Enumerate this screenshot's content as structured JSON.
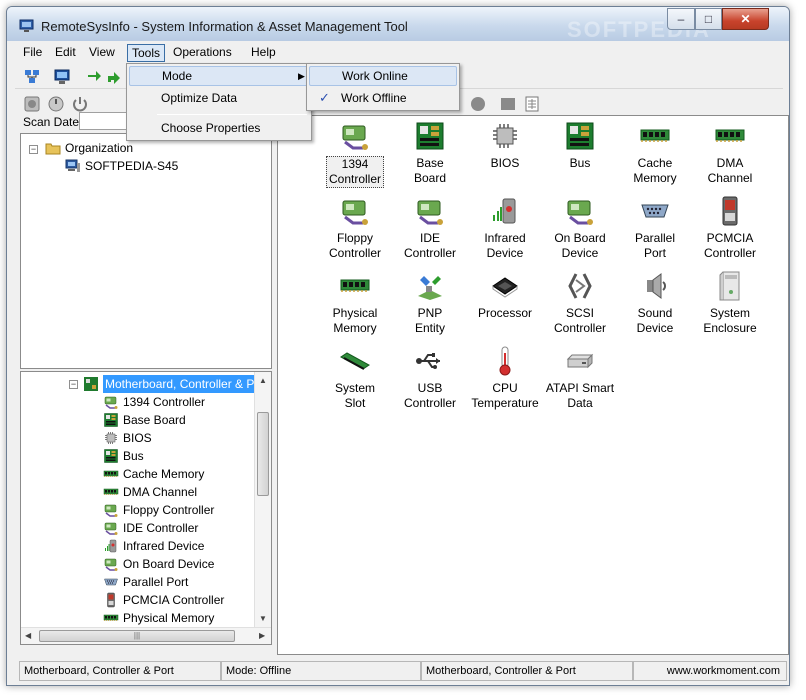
{
  "window": {
    "title": "RemoteSysInfo - System Information & Asset Management Tool",
    "watermark": "SOFTPEDIA"
  },
  "menu": {
    "file": "File",
    "edit": "Edit",
    "view": "View",
    "tools": "Tools",
    "operations": "Operations",
    "help": "Help"
  },
  "tools_menu": {
    "mode": "Mode",
    "optimize": "Optimize Data",
    "choose_properties": "Choose Properties"
  },
  "mode_submenu": {
    "work_online": "Work Online",
    "work_offline": "Work Offline",
    "checked": "Work Offline"
  },
  "scan": {
    "label": "Scan Date:",
    "value": ""
  },
  "tree_top": {
    "root": "Organization",
    "child": "SOFTPEDIA-S45"
  },
  "tree_bottom": {
    "selected": "Motherboard, Controller & Port",
    "items": [
      "1394 Controller",
      "Base Board",
      "BIOS",
      "Bus",
      "Cache Memory",
      "DMA Channel",
      "Floppy Controller",
      "IDE Controller",
      "Infrared Device",
      "On Board Device",
      "Parallel Port",
      "PCMCIA Controller",
      "Physical Memory",
      "PNP Entity"
    ]
  },
  "grid": {
    "items": [
      {
        "label": "1394 Controller",
        "icon": "controller-icon"
      },
      {
        "label": "Base Board",
        "icon": "motherboard-icon"
      },
      {
        "label": "BIOS",
        "icon": "chip-icon"
      },
      {
        "label": "Bus",
        "icon": "motherboard-icon"
      },
      {
        "label": "Cache Memory",
        "icon": "memory-icon"
      },
      {
        "label": "DMA Channel",
        "icon": "memory-icon"
      },
      {
        "label": "Floppy Controller",
        "icon": "controller-icon"
      },
      {
        "label": "IDE Controller",
        "icon": "controller-icon"
      },
      {
        "label": "Infrared Device",
        "icon": "infrared-icon"
      },
      {
        "label": "On Board Device",
        "icon": "controller-icon"
      },
      {
        "label": "Parallel Port",
        "icon": "port-icon"
      },
      {
        "label": "PCMCIA Controller",
        "icon": "pcmcia-icon"
      },
      {
        "label": "Physical Memory",
        "icon": "memory-icon"
      },
      {
        "label": "PNP Entity",
        "icon": "pnp-icon"
      },
      {
        "label": "Processor",
        "icon": "processor-icon"
      },
      {
        "label": "SCSI Controller",
        "icon": "scsi-icon"
      },
      {
        "label": "Sound Device",
        "icon": "speaker-icon"
      },
      {
        "label": "System Enclosure",
        "icon": "enclosure-icon"
      },
      {
        "label": "System Slot",
        "icon": "slot-icon"
      },
      {
        "label": "USB Controller",
        "icon": "usb-icon"
      },
      {
        "label": "CPU Temperature",
        "icon": "thermometer-icon"
      },
      {
        "label": "ATAPI Smart Data",
        "icon": "drive-icon"
      }
    ]
  },
  "status": {
    "category": "Motherboard, Controller & Port",
    "mode": "Mode: Offline",
    "current": "Motherboard, Controller & Port",
    "website": "www.workmoment.com"
  },
  "colors": {
    "selection": "#3399ff",
    "menu_highlight": "#dce7f5",
    "close_button": "#c8432c"
  }
}
